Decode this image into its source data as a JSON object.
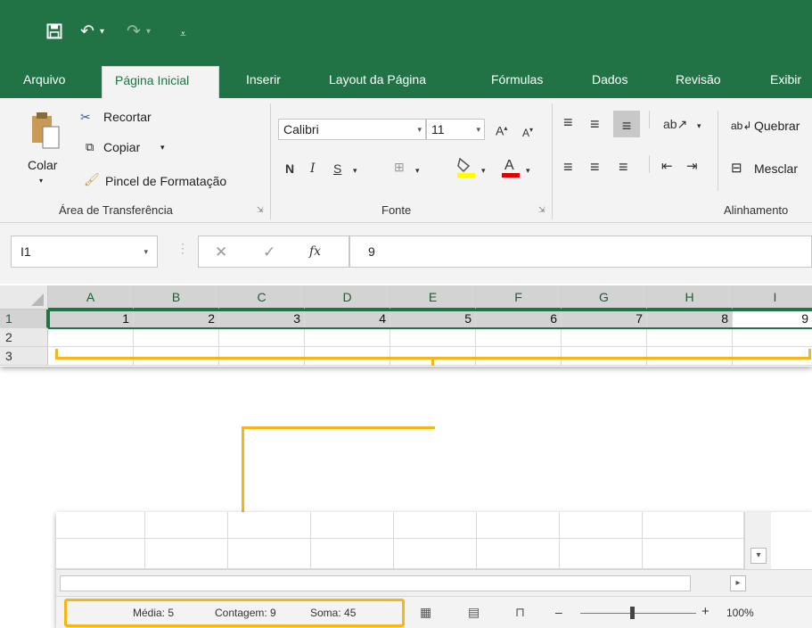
{
  "ribbon_tabs": [
    "Arquivo",
    "Página Inicial",
    "Inserir",
    "Layout da Página",
    "Fórmulas",
    "Dados",
    "Revisão",
    "Exibir"
  ],
  "clipboard": {
    "paste": "Colar",
    "cut": "Recortar",
    "copy": "Copiar",
    "format_painter": "Pincel de Formatação",
    "group_label": "Área de Transferência"
  },
  "font": {
    "name": "Calibri",
    "size": "11",
    "bold": "N",
    "italic": "I",
    "underline": "S",
    "group_label": "Fonte"
  },
  "alignment": {
    "wrap_text": "Quebrar",
    "merge": "Mesclar",
    "group_label": "Alinhamento"
  },
  "formula_bar": {
    "name_box": "I1",
    "fx": "fx",
    "content": "9"
  },
  "grid": {
    "columns": [
      "A",
      "B",
      "C",
      "D",
      "E",
      "F",
      "G",
      "H",
      "I"
    ],
    "rows": [
      "1",
      "2",
      "3"
    ],
    "row1_values": [
      "1",
      "2",
      "3",
      "4",
      "5",
      "6",
      "7",
      "8",
      "9"
    ]
  },
  "status_bar": {
    "average": "Média: 5",
    "count": "Contagem: 9",
    "sum": "Soma: 45",
    "zoom": "100%",
    "zoom_out": "–",
    "zoom_in": "+"
  },
  "colors": {
    "excel_green": "#217346",
    "highlight": "#f5b618"
  },
  "icons": [
    "save-icon",
    "undo-icon",
    "redo-icon",
    "customize-qat-icon",
    "paste-icon",
    "cut-icon",
    "copy-icon",
    "format-painter-icon",
    "increase-font-icon",
    "decrease-font-icon",
    "borders-icon",
    "fill-color-icon",
    "font-color-icon",
    "align-top-icon",
    "align-middle-icon",
    "align-bottom-icon",
    "orientation-icon",
    "align-left-icon",
    "center-icon",
    "align-right-icon",
    "decrease-indent-icon",
    "increase-indent-icon",
    "wrap-text-icon",
    "merge-icon",
    "cancel-icon",
    "enter-icon",
    "normal-view-icon",
    "page-layout-view-icon",
    "page-break-view-icon"
  ]
}
